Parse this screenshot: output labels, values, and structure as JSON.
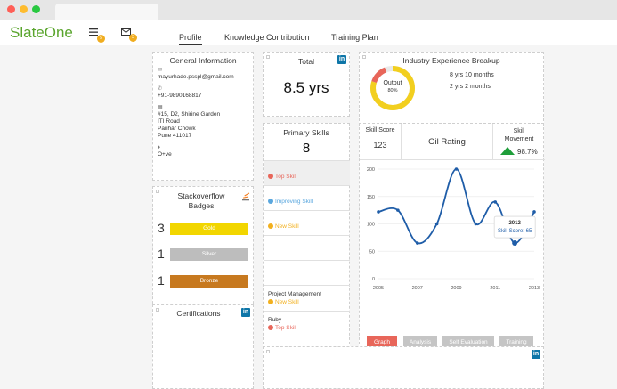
{
  "browser": {
    "colors": {
      "close": "#ff5f57",
      "minimize": "#febc2e",
      "maximize": "#28c840"
    }
  },
  "header": {
    "brand": "SlateOne",
    "menu_badge": "5",
    "mail_badge": "3",
    "tabs": [
      {
        "label": "Profile",
        "active": true
      },
      {
        "label": "Knowledge Contribution",
        "active": false
      },
      {
        "label": "Training Plan",
        "active": false
      }
    ]
  },
  "general_info": {
    "title": "General Information",
    "email": "mayurhade.psspl@gmail.com",
    "phone": "+91-9890168817",
    "address_lines": [
      "#15, D2, Shirine Garden",
      "ITI Road",
      "Parihar Chowk",
      "Pune 411017"
    ],
    "blood_group": "O+ve"
  },
  "stackoverflow": {
    "title": "Stackoverflow Badges",
    "logo_text": "stack overflow",
    "badges": [
      {
        "count": "3",
        "label": "Gold",
        "color": "#f2d600"
      },
      {
        "count": "1",
        "label": "Silver",
        "color": "#bdbdbd"
      },
      {
        "count": "1",
        "label": "Bronze",
        "color": "#c7791f"
      }
    ]
  },
  "certifications": {
    "title": "Certifications",
    "linkedin": "in"
  },
  "total": {
    "title": "Total",
    "value": "8.5 yrs",
    "linkedin": "in"
  },
  "primary_skills": {
    "title": "Primary Skills",
    "count": "8",
    "legend": [
      {
        "label": "Top Skill",
        "color": "#e8665a"
      },
      {
        "label": "Improving Skill",
        "color": "#5aa7de"
      },
      {
        "label": "New Skill",
        "color": "#f2b01e"
      }
    ],
    "skills": [
      {
        "name": "Project Management",
        "tag": "New Skill",
        "color": "#f2b01e"
      },
      {
        "name": "Ruby",
        "tag": "Top Skill",
        "color": "#e8665a"
      }
    ]
  },
  "industry": {
    "title": "Industry Experience Breakup",
    "donut_label": "Output",
    "donut_value": "80%",
    "donut_fraction": 0.8,
    "lines": [
      "8 yrs 10 months",
      "2 yrs 2 months"
    ]
  },
  "skill_panel": {
    "score_label": "Skill Score",
    "score_value": "123",
    "rating_label": "Oil Rating",
    "movement_label": "Skill Movement",
    "movement_value": "98.7%",
    "movement_color": "#1e9e3a"
  },
  "chart_data": {
    "type": "line",
    "x": [
      2005,
      2006,
      2007,
      2008,
      2009,
      2010,
      2011,
      2012,
      2013
    ],
    "values": [
      122,
      125,
      65,
      100,
      200,
      100,
      140,
      65,
      122
    ],
    "xticks": [
      "2005",
      "2007",
      "2009",
      "2011",
      "2013"
    ],
    "yticks": [
      "0",
      "50",
      "100",
      "150",
      "200"
    ],
    "ylim": [
      0,
      200
    ],
    "line_color": "#1f5da8",
    "grid": true,
    "tooltip": {
      "year": "2012",
      "text": "Skill Score: 65"
    }
  },
  "chart_buttons": [
    {
      "label": "Graph",
      "active": true
    },
    {
      "label": "Analysis",
      "active": false
    },
    {
      "label": "Self Evaluation",
      "active": false
    },
    {
      "label": "Training",
      "active": false
    }
  ],
  "bottom_panel": {
    "linkedin": "in"
  }
}
